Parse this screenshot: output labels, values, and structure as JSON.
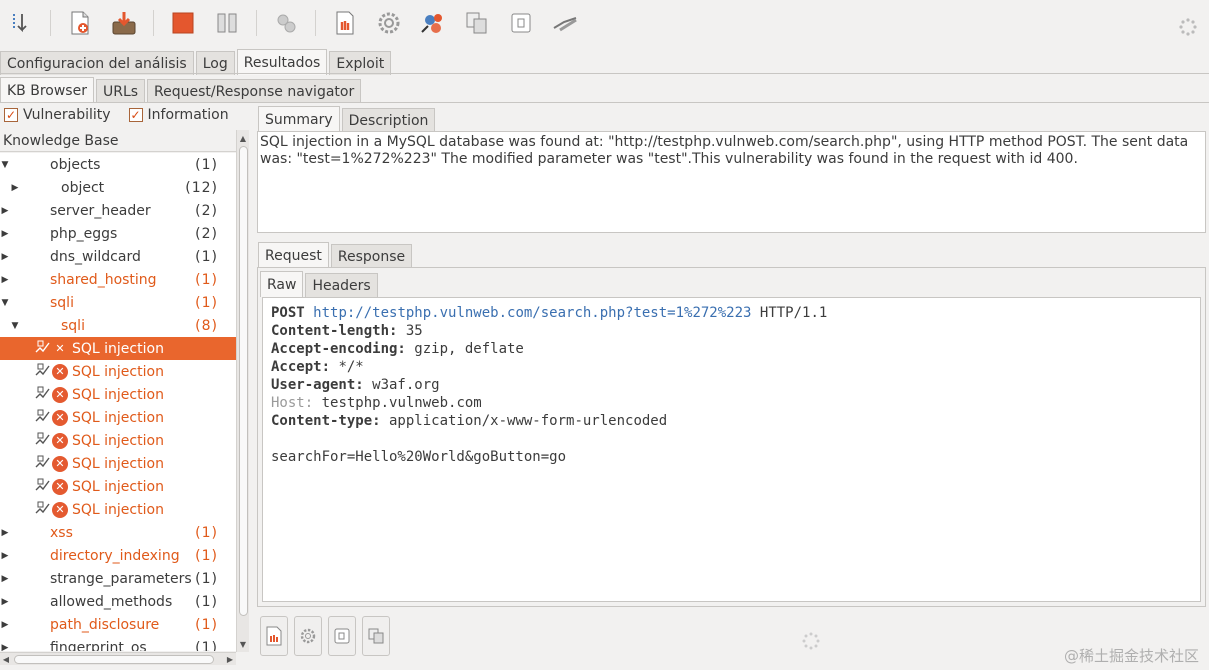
{
  "main_tabs": [
    "Configuracion del análisis",
    "Log",
    "Resultados",
    "Exploit"
  ],
  "sub_tabs": [
    "KB Browser",
    "URLs",
    "Request/Response navigator"
  ],
  "filters": {
    "vulnerability": "Vulnerability",
    "information": "Information"
  },
  "tree": {
    "header": "Knowledge Base",
    "items": [
      {
        "label": "objects",
        "count": "(1)",
        "state": "expanded",
        "level": 0,
        "orange": false
      },
      {
        "label": "object",
        "count": "(12)",
        "state": "collapsed",
        "level": 1,
        "orange": false
      },
      {
        "label": "server_header",
        "count": "(2)",
        "state": "collapsed",
        "level": 0,
        "orange": false
      },
      {
        "label": "php_eggs",
        "count": "(2)",
        "state": "collapsed",
        "level": 0,
        "orange": false
      },
      {
        "label": "dns_wildcard",
        "count": "(1)",
        "state": "collapsed",
        "level": 0,
        "orange": false
      },
      {
        "label": "shared_hosting",
        "count": "(1)",
        "state": "collapsed",
        "level": 0,
        "orange": true
      },
      {
        "label": "sqli",
        "count": "(1)",
        "state": "expanded",
        "level": 0,
        "orange": true
      },
      {
        "label": "sqli",
        "count": "(8)",
        "state": "expanded",
        "level": 1,
        "orange": true
      },
      {
        "label": "SQL injection",
        "count": "",
        "state": "vuln",
        "level": 2,
        "orange": true,
        "selected": true
      },
      {
        "label": "SQL injection",
        "count": "",
        "state": "vuln",
        "level": 2,
        "orange": true
      },
      {
        "label": "SQL injection",
        "count": "",
        "state": "vuln",
        "level": 2,
        "orange": true
      },
      {
        "label": "SQL injection",
        "count": "",
        "state": "vuln",
        "level": 2,
        "orange": true
      },
      {
        "label": "SQL injection",
        "count": "",
        "state": "vuln",
        "level": 2,
        "orange": true
      },
      {
        "label": "SQL injection",
        "count": "",
        "state": "vuln",
        "level": 2,
        "orange": true
      },
      {
        "label": "SQL injection",
        "count": "",
        "state": "vuln",
        "level": 2,
        "orange": true
      },
      {
        "label": "SQL injection",
        "count": "",
        "state": "vuln",
        "level": 2,
        "orange": true
      },
      {
        "label": "xss",
        "count": "(1)",
        "state": "collapsed",
        "level": 0,
        "orange": true
      },
      {
        "label": "directory_indexing",
        "count": "(1)",
        "state": "collapsed",
        "level": 0,
        "orange": true
      },
      {
        "label": "strange_parameters",
        "count": "(1)",
        "state": "collapsed",
        "level": 0,
        "orange": false
      },
      {
        "label": "allowed_methods",
        "count": "(1)",
        "state": "collapsed",
        "level": 0,
        "orange": false
      },
      {
        "label": "path_disclosure",
        "count": "(1)",
        "state": "collapsed",
        "level": 0,
        "orange": true
      },
      {
        "label": "fingerprint_os",
        "count": "(1)",
        "state": "collapsed",
        "level": 0,
        "orange": false
      }
    ]
  },
  "detail_tabs": [
    "Summary",
    "Description"
  ],
  "summary_text": "SQL injection in a MySQL database was found at: \"http://testphp.vulnweb.com/search.php\", using HTTP method POST. The sent data was: \"test=1%272%223\" The modified parameter was \"test\".This vulnerability was found in the request with id 400.",
  "request_tabs": [
    "Request",
    "Response"
  ],
  "view_tabs": [
    "Raw",
    "Headers"
  ],
  "request": {
    "method": "POST",
    "url": "http://testphp.vulnweb.com/search.php?test=1%272%223",
    "protocol": "HTTP/1.1",
    "headers": [
      {
        "name": "Content-length:",
        "value": " 35",
        "style": "bold"
      },
      {
        "name": "Accept-encoding:",
        "value": " gzip, deflate",
        "style": "bold"
      },
      {
        "name": "Accept:",
        "value": " */*",
        "style": "bold"
      },
      {
        "name": "User-agent:",
        "value": " w3af.org",
        "style": "bold"
      },
      {
        "name": "Host:",
        "value": " testphp.vulnweb.com",
        "style": "grey"
      },
      {
        "name": "Content-type:",
        "value": " application/x-www-form-urlencoded",
        "style": "bold"
      }
    ],
    "body": "searchFor=Hello%20World&goButton=go"
  },
  "colors": {
    "accent": "#e9662d",
    "orange_text": "#e05a1a",
    "url": "#3a6fb0"
  },
  "watermark": "@稀土掘金技术社区"
}
